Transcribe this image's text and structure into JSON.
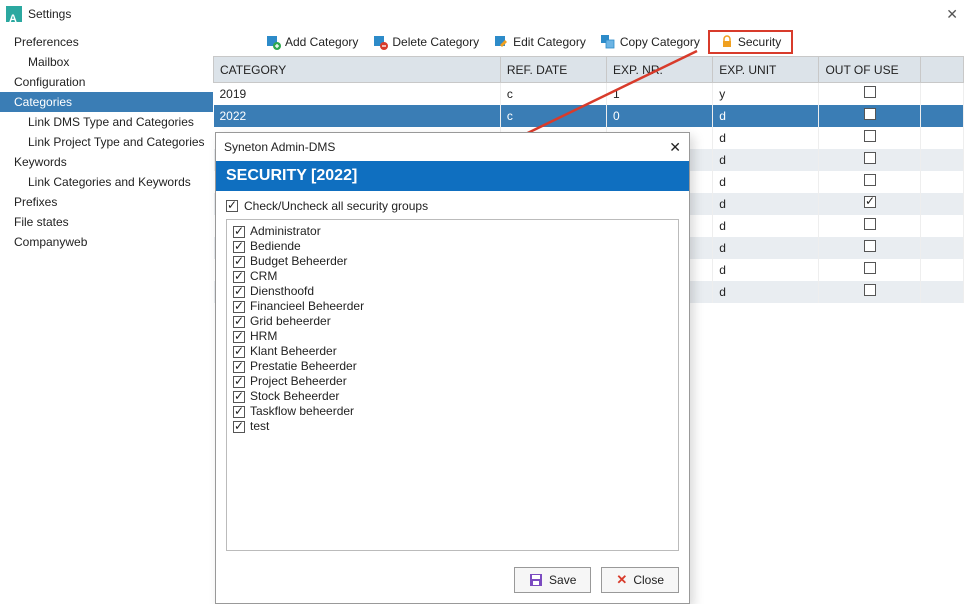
{
  "window": {
    "title": "Settings"
  },
  "sidebar": {
    "items": [
      {
        "label": "Preferences",
        "sub": false
      },
      {
        "label": "Mailbox",
        "sub": true
      },
      {
        "label": "Configuration",
        "sub": false
      },
      {
        "label": "Categories",
        "sub": false,
        "selected": true
      },
      {
        "label": "Link DMS Type and Categories",
        "sub": true
      },
      {
        "label": "Link Project Type and Categories",
        "sub": true
      },
      {
        "label": "Keywords",
        "sub": false
      },
      {
        "label": "Link Categories and Keywords",
        "sub": true
      },
      {
        "label": "Prefixes",
        "sub": false
      },
      {
        "label": "File states",
        "sub": false
      },
      {
        "label": "Companyweb",
        "sub": false
      }
    ]
  },
  "toolbar": {
    "add": "Add Category",
    "del": "Delete Category",
    "edit": "Edit Category",
    "copy": "Copy Category",
    "security": "Security"
  },
  "table": {
    "headers": [
      "CATEGORY",
      "REF. DATE",
      "EXP. NR.",
      "EXP. UNIT",
      "OUT OF USE",
      ""
    ],
    "rows": [
      {
        "category": "2019",
        "ref": "c",
        "nr": "1",
        "unit": "y",
        "out": false,
        "sel": false
      },
      {
        "category": "2022",
        "ref": "c",
        "nr": "0",
        "unit": "d",
        "out": false,
        "sel": true
      },
      {
        "category": "",
        "ref": "",
        "nr": "",
        "unit": "d",
        "out": false,
        "sel": false
      },
      {
        "category": "",
        "ref": "",
        "nr": "",
        "unit": "d",
        "out": false,
        "sel": false
      },
      {
        "category": "",
        "ref": "",
        "nr": "",
        "unit": "d",
        "out": false,
        "sel": false
      },
      {
        "category": "",
        "ref": "",
        "nr": "",
        "unit": "d",
        "out": true,
        "sel": false
      },
      {
        "category": "",
        "ref": "",
        "nr": "",
        "unit": "d",
        "out": false,
        "sel": false
      },
      {
        "category": "",
        "ref": "",
        "nr": "",
        "unit": "d",
        "out": false,
        "sel": false
      },
      {
        "category": "",
        "ref": "",
        "nr": "",
        "unit": "d",
        "out": false,
        "sel": false
      },
      {
        "category": "",
        "ref": "",
        "nr": "",
        "unit": "d",
        "out": false,
        "sel": false
      }
    ]
  },
  "modal": {
    "title": "Syneton Admin-DMS",
    "heading": "SECURITY [2022]",
    "toggle_label": "Check/Uncheck all security groups",
    "toggle_checked": true,
    "groups": [
      "Administrator",
      "Bediende",
      "Budget Beheerder",
      "CRM",
      "Diensthoofd",
      "Financieel Beheerder",
      "Grid beheerder",
      "HRM",
      "Klant Beheerder",
      "Prestatie Beheerder",
      "Project Beheerder",
      "Stock Beheerder",
      "Taskflow beheerder",
      "test"
    ],
    "save": "Save",
    "close": "Close"
  }
}
